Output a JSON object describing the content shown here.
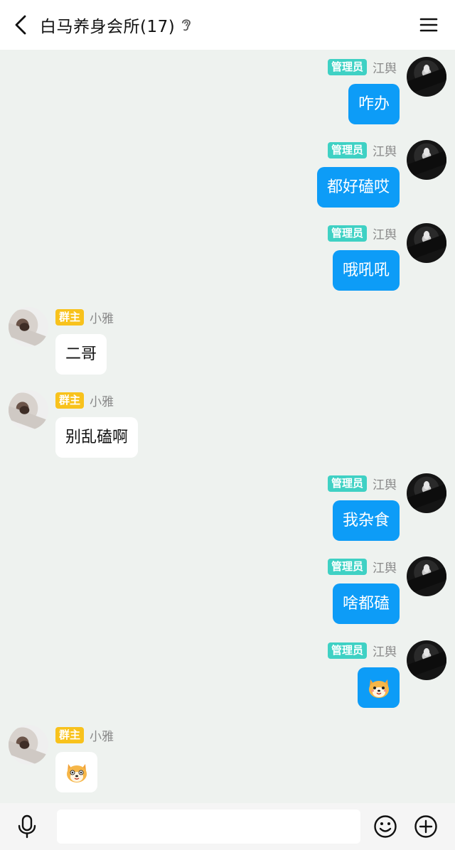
{
  "header": {
    "title": "白马养身会所(17)",
    "back_icon": "chevron-left-icon",
    "ear_icon": "ear-icon",
    "menu_icon": "hamburger-menu-icon"
  },
  "colors": {
    "self_bubble": "#0d9cf7",
    "other_bubble": "#ffffff",
    "admin_badge": "#3fd1c4",
    "owner_badge": "#f8c21c",
    "chat_bg": "#eef2ef"
  },
  "messages": [
    {
      "side": "right",
      "badge": "管理员",
      "name": "江舆",
      "text": "咋办"
    },
    {
      "side": "right",
      "badge": "管理员",
      "name": "江舆",
      "text": "都好磕哎"
    },
    {
      "side": "right",
      "badge": "管理员",
      "name": "江舆",
      "text": "哦吼吼"
    },
    {
      "side": "left",
      "badge": "群主",
      "name": "小雅",
      "text": "二哥"
    },
    {
      "side": "left",
      "badge": "群主",
      "name": "小雅",
      "text": "别乱磕啊"
    },
    {
      "side": "right",
      "badge": "管理员",
      "name": "江舆",
      "text": "我杂食"
    },
    {
      "side": "right",
      "badge": "管理员",
      "name": "江舆",
      "text": "啥都磕"
    },
    {
      "side": "right",
      "badge": "管理员",
      "name": "江舆",
      "sticker": "shiba-dog-sticker-icon"
    },
    {
      "side": "left",
      "badge": "群主",
      "name": "小雅",
      "sticker": "shiba-dog-sticker-icon"
    }
  ],
  "input_bar": {
    "mic_icon": "microphone-icon",
    "input_value": "",
    "input_placeholder": "",
    "emoji_icon": "smiley-icon",
    "plus_icon": "plus-circle-icon"
  }
}
